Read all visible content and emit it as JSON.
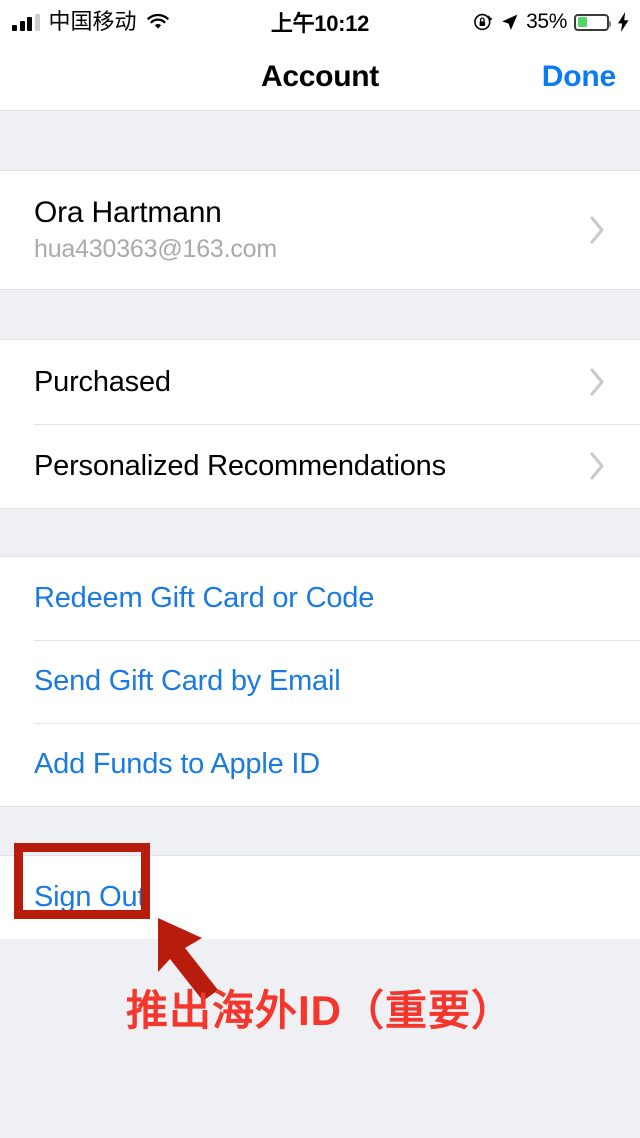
{
  "status_bar": {
    "carrier": "中国移动",
    "time": "上午10:12",
    "battery_percent": "35%",
    "battery_level": 35,
    "signal_bars_filled": 3,
    "signal_bars_total": 4,
    "icons": [
      "signal-bars-icon",
      "wifi-icon",
      "rotation-lock-icon",
      "location-arrow-icon",
      "battery-icon",
      "charging-bolt-icon"
    ],
    "battery_color": "#4cd964"
  },
  "nav_bar": {
    "title": "Account",
    "done_label": "Done",
    "accent_color": "#0a7cf3"
  },
  "sections": [
    {
      "rows": [
        {
          "name": "Ora Hartmann",
          "email": "hua430363@163.com",
          "accessory": "chevron-right-icon"
        }
      ]
    },
    {
      "rows": [
        {
          "label": "Purchased",
          "accessory": "chevron-right-icon"
        },
        {
          "label": "Personalized Recommendations",
          "accessory": "chevron-right-icon"
        }
      ]
    },
    {
      "rows": [
        {
          "label": "Redeem Gift Card or Code"
        },
        {
          "label": "Send Gift Card by Email"
        },
        {
          "label": "Add Funds to Apple ID"
        }
      ]
    },
    {
      "rows": [
        {
          "label": "Sign Out"
        }
      ]
    }
  ],
  "annotation": {
    "caption": "推出海外ID（重要）",
    "caption_color": "#f4362c",
    "box_color": "#b81c0d",
    "arrow_color": "#b81c0d",
    "highlighted_target": "Sign Out"
  },
  "colors": {
    "link_blue": "#1a7ae0",
    "background_gray": "#eff0f4",
    "card_white": "#ffffff",
    "separator": "#e2e3e7",
    "secondary_text": "#a9aaae"
  }
}
